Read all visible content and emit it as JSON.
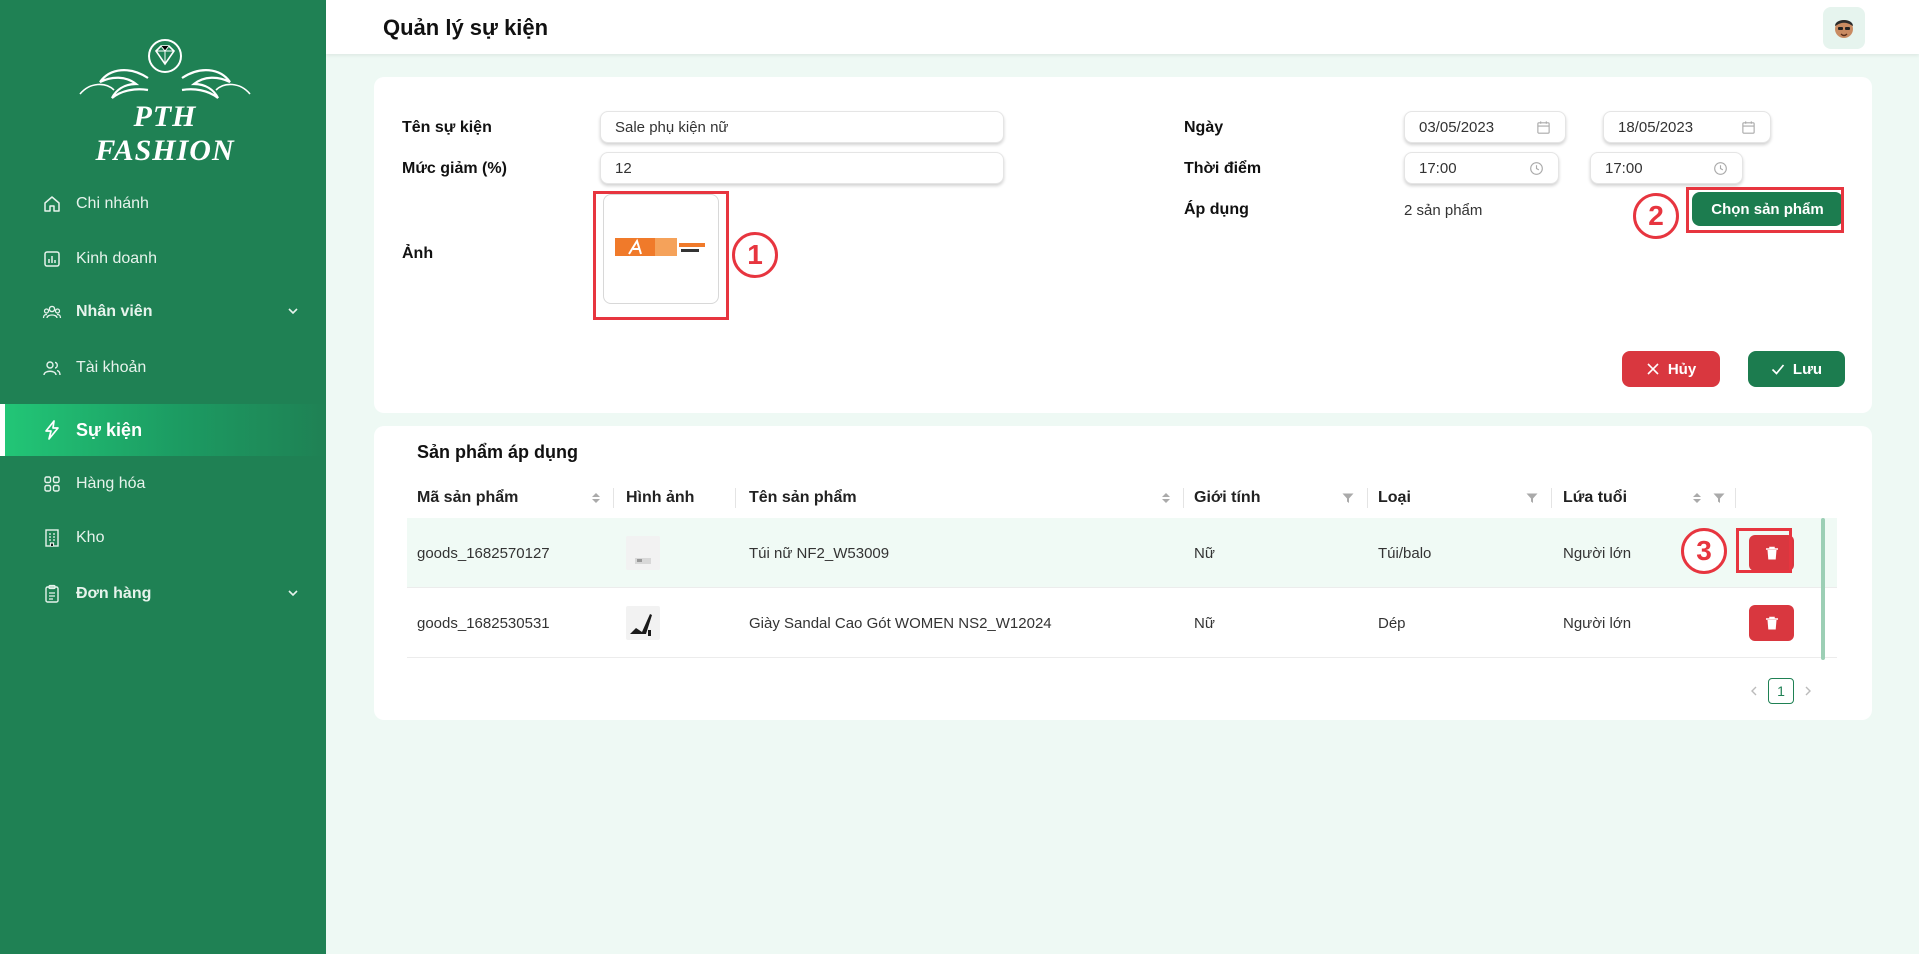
{
  "sidebar": {
    "brand": "PTH FASHION",
    "items": [
      {
        "label": "Chi nhánh"
      },
      {
        "label": "Kinh doanh"
      },
      {
        "label": "Nhân viên"
      },
      {
        "label": "Tài khoản"
      },
      {
        "label": "Sự kiện"
      },
      {
        "label": "Hàng hóa"
      },
      {
        "label": "Kho"
      },
      {
        "label": "Đơn hàng"
      }
    ]
  },
  "header": {
    "title": "Quản lý sự kiện"
  },
  "form": {
    "name_label": "Tên sự kiện",
    "name_value": "Sale phụ kiện nữ",
    "discount_label": "Mức giảm (%)",
    "discount_value": "12",
    "image_label": "Ảnh",
    "date_label": "Ngày",
    "date_start": "03/05/2023",
    "date_end": "18/05/2023",
    "time_label": "Thời điểm",
    "time_start": "17:00",
    "time_end": "17:00",
    "apply_label": "Áp dụng",
    "apply_value": "2 sản phẩm",
    "choose_label": "Chọn sản phẩm",
    "cancel_label": "Hủy",
    "save_label": "Lưu"
  },
  "annotations": [
    "1",
    "2",
    "3"
  ],
  "table": {
    "title": "Sản phẩm áp dụng",
    "columns": [
      "Mã sản phẩm",
      "Hình ảnh",
      "Tên sản phẩm",
      "Giới tính",
      "Loại",
      "Lứa tuổi"
    ],
    "rows": [
      {
        "code": "goods_1682570127",
        "name": "Túi nữ NF2_W53009",
        "gender": "Nữ",
        "type": "Túi/balo",
        "age": "Người lớn"
      },
      {
        "code": "goods_1682530531",
        "name": "Giày Sandal Cao Gót WOMEN NS2_W12024",
        "gender": "Nữ",
        "type": "Dép",
        "age": "Người lớn"
      }
    ],
    "page": "1"
  },
  "colors": {
    "sidebar": "#1f8154",
    "primary": "#1c7c4f",
    "danger": "#d9373f",
    "highlight": "#e7353f"
  }
}
